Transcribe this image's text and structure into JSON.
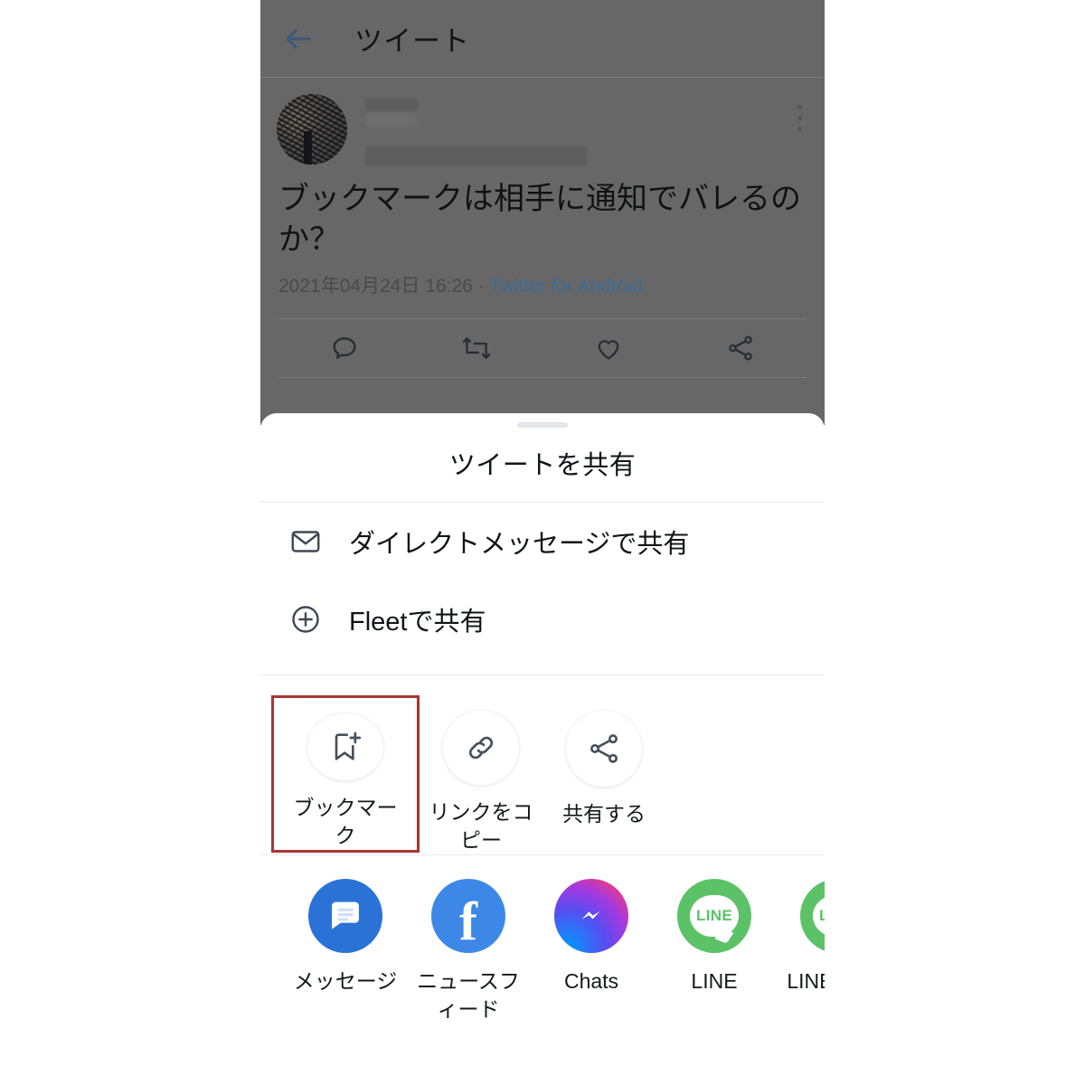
{
  "app": {
    "header_title": "ツイート",
    "back_icon": "back-arrow-icon",
    "overflow_icon": "kebab-menu-icon"
  },
  "tweet": {
    "author_redacted": true,
    "text": "ブックマークは相手に通知でバレるのか？",
    "timestamp": "2021年04月24日 16:26 · ",
    "source": "Twitter for Android",
    "actions": [
      {
        "name": "reply-icon",
        "label": "reply"
      },
      {
        "name": "retweet-icon",
        "label": "retweet"
      },
      {
        "name": "like-icon",
        "label": "like"
      },
      {
        "name": "share-icon",
        "label": "share"
      }
    ]
  },
  "share_sheet": {
    "title": "ツイートを共有",
    "menu_items": [
      {
        "icon": "envelope-icon",
        "label": "ダイレクトメッセージで共有"
      },
      {
        "icon": "plus-circle-icon",
        "label": "Fleetで共有"
      }
    ],
    "actions": [
      {
        "icon": "bookmark-add-icon",
        "label": "ブックマーク",
        "highlighted": true
      },
      {
        "icon": "link-icon",
        "label": "リンクをコピー",
        "highlighted": false
      },
      {
        "icon": "share-nodes-icon",
        "label": "共有する",
        "highlighted": false
      }
    ],
    "apps": [
      {
        "icon": "google-messages-icon",
        "label": "メッセージ"
      },
      {
        "icon": "facebook-icon",
        "label": "ニュースフィード"
      },
      {
        "icon": "messenger-icon",
        "label": "Chats"
      },
      {
        "icon": "line-icon",
        "label": "LINE"
      },
      {
        "icon": "line-keep-icon",
        "label": "LINE Keep"
      }
    ]
  },
  "colors": {
    "accent_blue": "#3d5a79",
    "link_blue": "#3c6b96",
    "highlight_red": "#a93535",
    "backdrop": "#676767",
    "sheet_bg": "#ffffff",
    "line_green": "#5bc268",
    "facebook_blue": "#3d87e6",
    "messages_blue": "#2b72d6"
  }
}
